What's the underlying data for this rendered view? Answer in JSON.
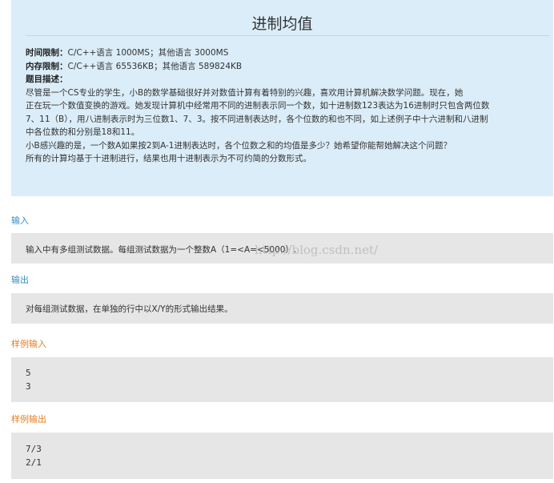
{
  "problem": {
    "title": "进制均值",
    "time_limit_label": "时间限制：",
    "time_limit_value": "C/C++语言 1000MS；其他语言 3000MS",
    "memory_limit_label": "内存限制：",
    "memory_limit_value": "C/C++语言 65536KB；其他语言 589824KB",
    "desc_label": "题目描述：",
    "desc_lines": [
      "尽管是一个CS专业的学生，小B的数学基础很好并对数值计算有着特别的兴趣，喜欢用计算机解决数学问题。现在，她",
      "正在玩一个数值变换的游戏。她发现计算机中经常用不同的进制表示同一个数，如十进制数123表达为16进制时只包含两位数",
      "7、11（B），用八进制表示时为三位数1、7、3。按不同进制表达时，各个位数的和也不同，如上述例子中十六进制和八进制",
      "中各位数的和分别是18和11。",
      "小B感兴趣的是，一个数A如果按2到A-1进制表达时，各个位数之和的均值是多少？她希望你能帮她解决这个问题？",
      "所有的计算均基于十进制进行，结果也用十进制表示为不可约简的分数形式。"
    ]
  },
  "sections": {
    "input_label": "输入",
    "input_text": "输入中有多组测试数据。每组测试数据为一个整数A（1=<A=<5000）.",
    "output_label": "输出",
    "output_text": "对每组测试数据，在单独的行中以X/Y的形式输出结果。",
    "sample_input_label": "样例输入",
    "sample_input_lines": [
      "5",
      "3"
    ],
    "sample_output_label": "样例输出",
    "sample_output_lines": [
      "7/3",
      "2/1"
    ]
  },
  "watermark": "http://blog.csdn.net/",
  "colors": {
    "header_bg": "#dbedf8",
    "box_bg": "#e6e6e6",
    "label_blue": "#3a8cc4",
    "label_orange": "#e67e22"
  }
}
